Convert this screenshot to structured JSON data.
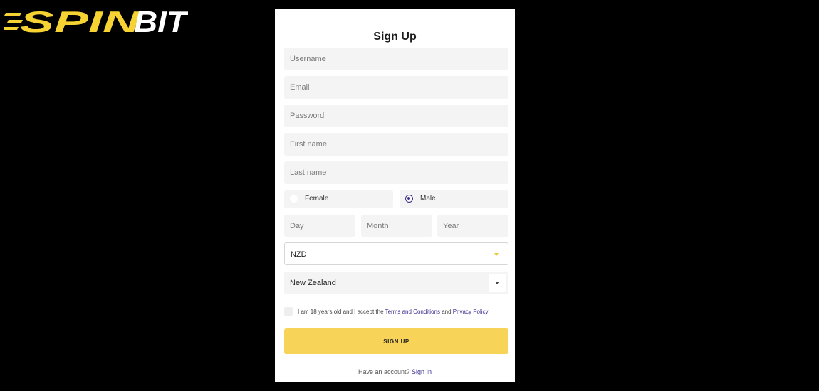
{
  "brand": {
    "logo_text": "SPINBIT",
    "logo_color": "#f6d332"
  },
  "form": {
    "title": "Sign Up",
    "username_placeholder": "Username",
    "email_placeholder": "Email",
    "password_placeholder": "Password",
    "first_name_placeholder": "First name",
    "last_name_placeholder": "Last name",
    "gender": {
      "female_label": "Female",
      "male_label": "Male",
      "selected": "Male"
    },
    "dob": {
      "day_placeholder": "Day",
      "month_placeholder": "Month",
      "year_placeholder": "Year"
    },
    "currency": {
      "value": "NZD"
    },
    "country": {
      "value": "New Zealand"
    },
    "terms": {
      "prefix": "I am 18 years old and I accept the ",
      "terms_link": "Terms and Conditions",
      "and": " and ",
      "privacy_link": "Privacy Policy"
    },
    "submit_label": "SIGN UP",
    "have_account": "Have an account? ",
    "signin_link": "Sign In"
  },
  "colors": {
    "accent_yellow": "#f7d358",
    "link_purple": "#3a2f8f",
    "background": "#000000"
  }
}
